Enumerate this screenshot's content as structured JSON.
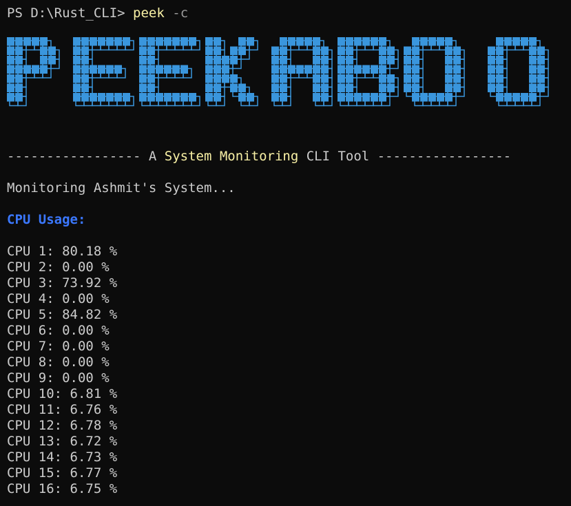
{
  "prompt": {
    "text": "PS D:\\Rust_CLI> ",
    "command": "peek",
    "flag": "-c"
  },
  "banner": {
    "text": "PEEKABOO",
    "fill_color": "#3a96dd",
    "shadow_color": "#3a96dd"
  },
  "tagline": {
    "left_dashes": "----------------- ",
    "pre": "A ",
    "highlight": "System Monitoring",
    "post": " CLI Tool ",
    "right_dashes": "-----------------"
  },
  "monitoring_text": "Monitoring Ashmit's System...",
  "cpu_heading": "CPU Usage:",
  "cpu_lines": [
    "CPU 1: 80.18 %",
    "CPU 2: 0.00 %",
    "CPU 3: 73.92 %",
    "CPU 4: 0.00 %",
    "CPU 5: 84.82 %",
    "CPU 6: 0.00 %",
    "CPU 7: 0.00 %",
    "CPU 8: 0.00 %",
    "CPU 9: 0.00 %",
    "CPU 10: 6.81 %",
    "CPU 11: 6.76 %",
    "CPU 12: 6.78 %",
    "CPU 13: 6.72 %",
    "CPU 14: 6.73 %",
    "CPU 15: 6.77 %",
    "CPU 16: 6.75 %"
  ],
  "colors": {
    "background": "#0c0c0c",
    "text": "#cccccc",
    "command": "#f9f1a5",
    "heading_blue": "#3b78ff"
  }
}
